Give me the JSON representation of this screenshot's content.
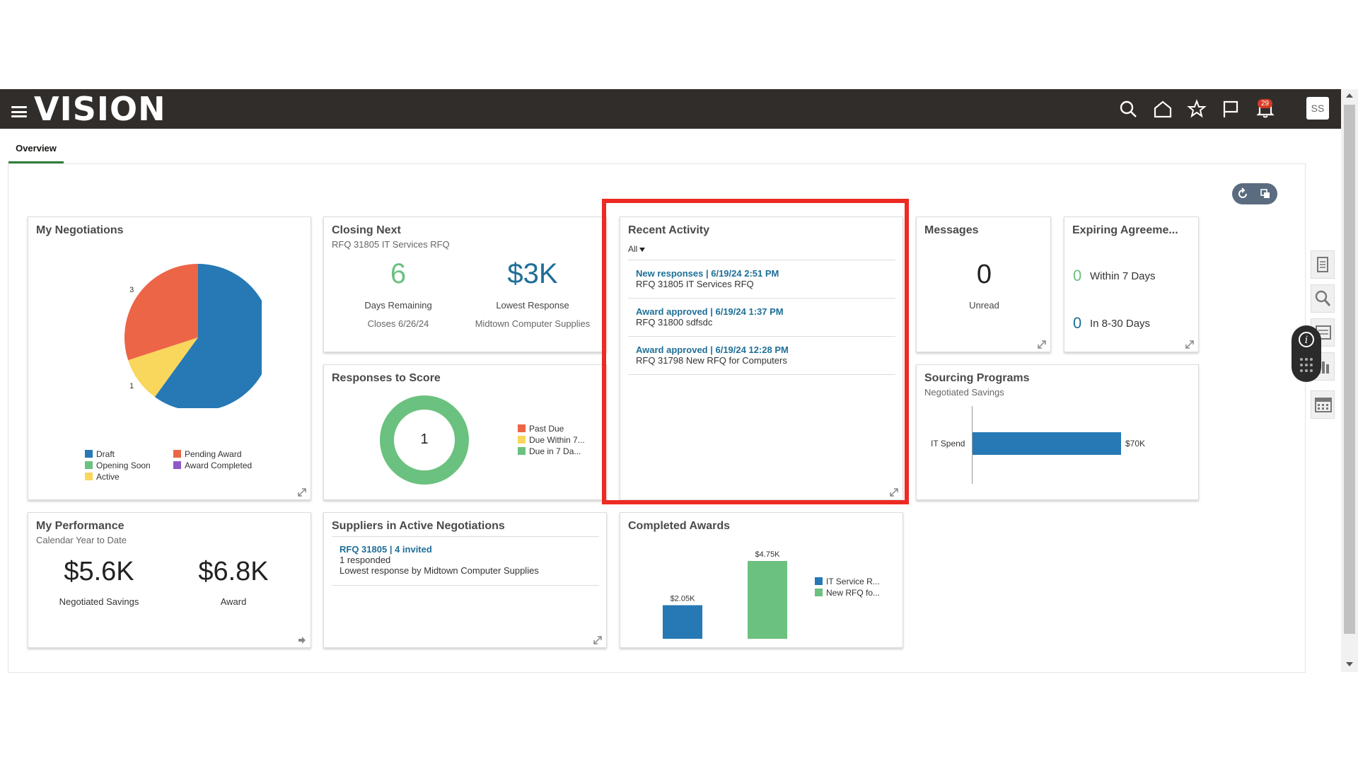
{
  "header": {
    "logo": "VISION",
    "notification_count": "29",
    "avatar_initials": "SS"
  },
  "tabs": [
    {
      "label": "Overview"
    }
  ],
  "cards": {
    "negotiations": {
      "title": "My Negotiations",
      "pie_values": [
        {
          "label": "6",
          "value": 6,
          "color": "#2679b4"
        },
        {
          "label": "1",
          "value": 1,
          "color": "#f9d65c"
        },
        {
          "label": "3",
          "value": 3,
          "color": "#ec6547"
        }
      ],
      "legend": [
        {
          "label": "Draft",
          "color": "#2679b4"
        },
        {
          "label": "Pending Award",
          "color": "#ec6547"
        },
        {
          "label": "Opening Soon",
          "color": "#6bc17f"
        },
        {
          "label": "Award Completed",
          "color": "#8e5ac8"
        },
        {
          "label": "Active",
          "color": "#f9d65c"
        }
      ]
    },
    "closing_next": {
      "title": "Closing Next",
      "subtitle": "RFQ 31805 IT Services RFQ",
      "days_value": "6",
      "days_label": "Days Remaining",
      "closes": "Closes 6/26/24",
      "lowest_value": "$3K",
      "lowest_label": "Lowest Response",
      "lowest_supplier": "Midtown Computer Supplies"
    },
    "recent_activity": {
      "title": "Recent Activity",
      "filter": "All",
      "items": [
        {
          "link": "New responses | 6/19/24 2:51 PM",
          "desc": "RFQ 31805 IT Services RFQ"
        },
        {
          "link": "Award approved | 6/19/24 1:37 PM",
          "desc": "RFQ 31800 sdfsdc"
        },
        {
          "link": "Award approved | 6/19/24 12:28 PM",
          "desc": "RFQ 31798 New RFQ for Computers"
        }
      ]
    },
    "messages": {
      "title": "Messages",
      "count": "0",
      "label": "Unread"
    },
    "expiring": {
      "title": "Expiring Agreeme...",
      "rows": [
        {
          "value": "0",
          "label": "Within 7 Days",
          "color": "#6bc17f"
        },
        {
          "value": "0",
          "label": "In 8-30 Days",
          "color": "#1e6f97"
        }
      ]
    },
    "responses": {
      "title": "Responses to Score",
      "center_value": "1",
      "legend": [
        {
          "label": "Past Due",
          "color": "#ec6547"
        },
        {
          "label": "Due Within 7...",
          "color": "#f9d65c"
        },
        {
          "label": "Due in 7 Da...",
          "color": "#6bc17f"
        }
      ]
    },
    "sourcing": {
      "title": "Sourcing Programs",
      "subtitle": "Negotiated Savings",
      "bar_label": "IT Spend",
      "bar_value_label": "$70K",
      "bar_value": 70
    },
    "performance": {
      "title": "My Performance",
      "subtitle": "Calendar Year to Date",
      "savings_value": "$5.6K",
      "savings_label": "Negotiated Savings",
      "award_value": "$6.8K",
      "award_label": "Award"
    },
    "suppliers": {
      "title": "Suppliers in Active Negotiations",
      "link": "RFQ 31805 | 4 invited",
      "line1": "1 responded",
      "line2": "Lowest response by Midtown Computer Supplies"
    },
    "completed_awards": {
      "title": "Completed Awards",
      "legend": [
        {
          "label": "IT Service R...",
          "color": "#2679b4"
        },
        {
          "label": "New RFQ fo...",
          "color": "#6bc17f"
        }
      ]
    }
  },
  "chart_data": [
    {
      "type": "pie",
      "title": "My Negotiations",
      "categories": [
        "Draft",
        "Active",
        "Pending Award"
      ],
      "values": [
        6,
        1,
        3
      ]
    },
    {
      "type": "bar",
      "title": "Completed Awards",
      "categories": [
        "IT Service R...",
        "New RFQ fo..."
      ],
      "values": [
        2.05,
        4.75
      ],
      "value_labels": [
        "$2.05K",
        "$4.75K"
      ],
      "units": "$K"
    },
    {
      "type": "bar",
      "title": "Sourcing Programs",
      "categories": [
        "IT Spend"
      ],
      "values": [
        70
      ],
      "value_labels": [
        "$70K"
      ],
      "units": "$K"
    }
  ]
}
